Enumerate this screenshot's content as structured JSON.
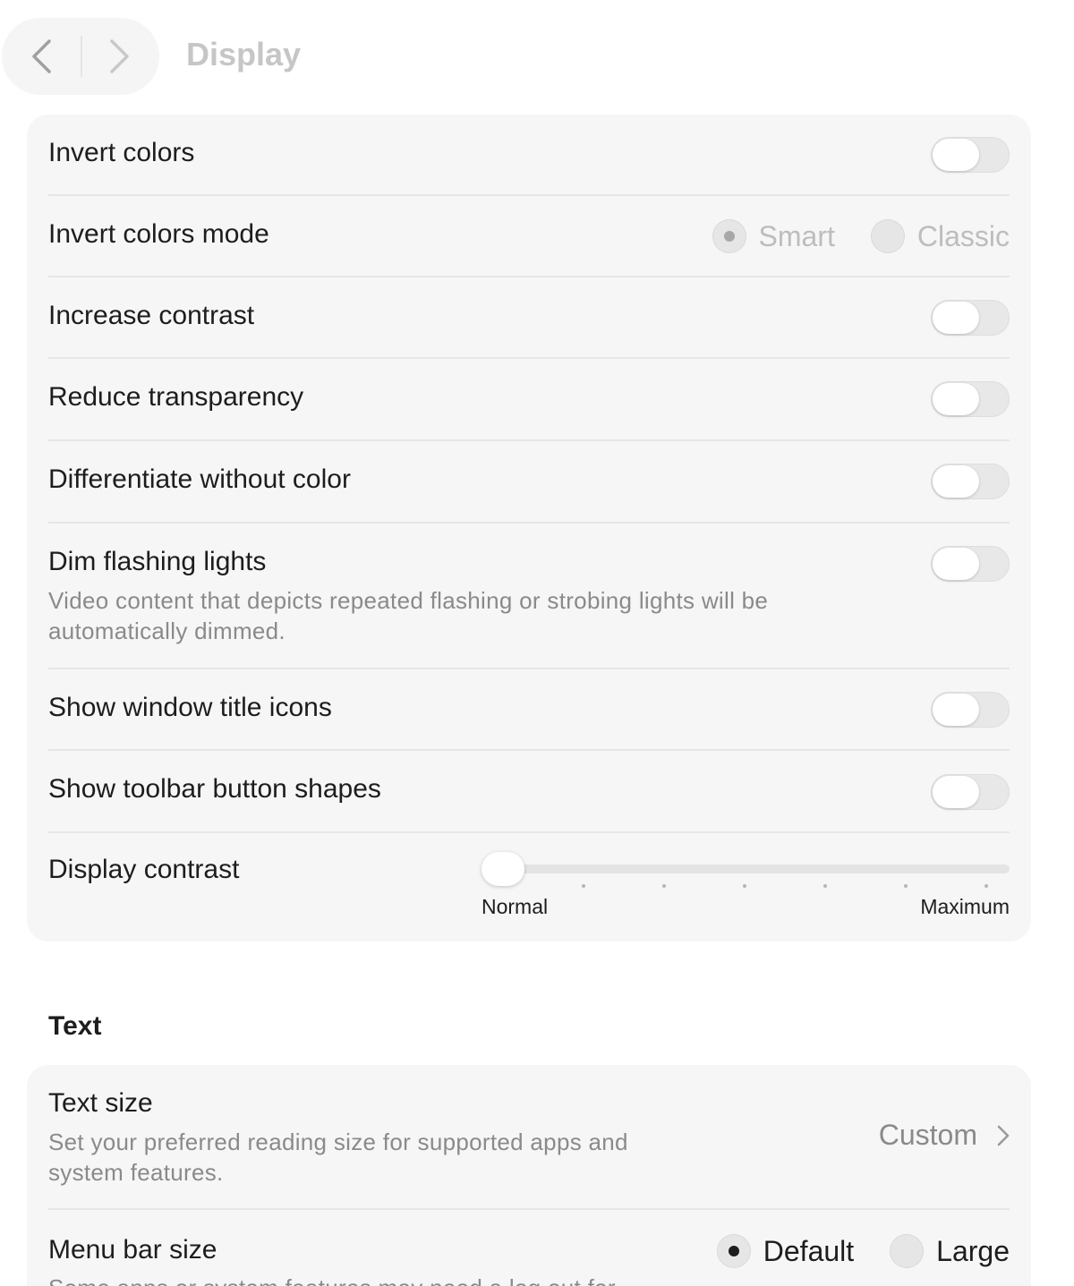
{
  "header": {
    "title": "Display"
  },
  "display": {
    "rows": [
      {
        "label": "Invert colors",
        "type": "toggle",
        "on": false
      },
      {
        "label": "Invert colors mode",
        "type": "radio",
        "options": [
          "Smart",
          "Classic"
        ],
        "selected": "Smart"
      },
      {
        "label": "Increase contrast",
        "type": "toggle",
        "on": false
      },
      {
        "label": "Reduce transparency",
        "type": "toggle",
        "on": false
      },
      {
        "label": "Differentiate without color",
        "type": "toggle",
        "on": false
      },
      {
        "label": "Dim flashing lights",
        "type": "toggle",
        "on": false,
        "desc_line1": "Video content that depicts repeated flashing or strobing lights will be",
        "desc_line2": "automatically dimmed."
      },
      {
        "label": "Show window title icons",
        "type": "toggle",
        "on": false
      },
      {
        "label": "Show toolbar button shapes",
        "type": "toggle",
        "on": false
      }
    ],
    "contrast": {
      "label": "Display contrast",
      "min_label": "Normal",
      "max_label": "Maximum",
      "value_fraction": 0
    }
  },
  "text_section": {
    "heading": "Text",
    "text_size": {
      "label": "Text size",
      "desc_line1": "Set your preferred reading size for supported apps and",
      "desc_line2": "system features.",
      "value": "Custom"
    },
    "menu_bar_size": {
      "label": "Menu bar size",
      "options": [
        "Default",
        "Large"
      ],
      "selected": "Default",
      "desc_line1": "Some apps or system features may need a log out for"
    }
  },
  "icons": {
    "back": "chevron-left-icon",
    "forward": "chevron-right-icon",
    "disclosure": "chevron-right-icon"
  }
}
